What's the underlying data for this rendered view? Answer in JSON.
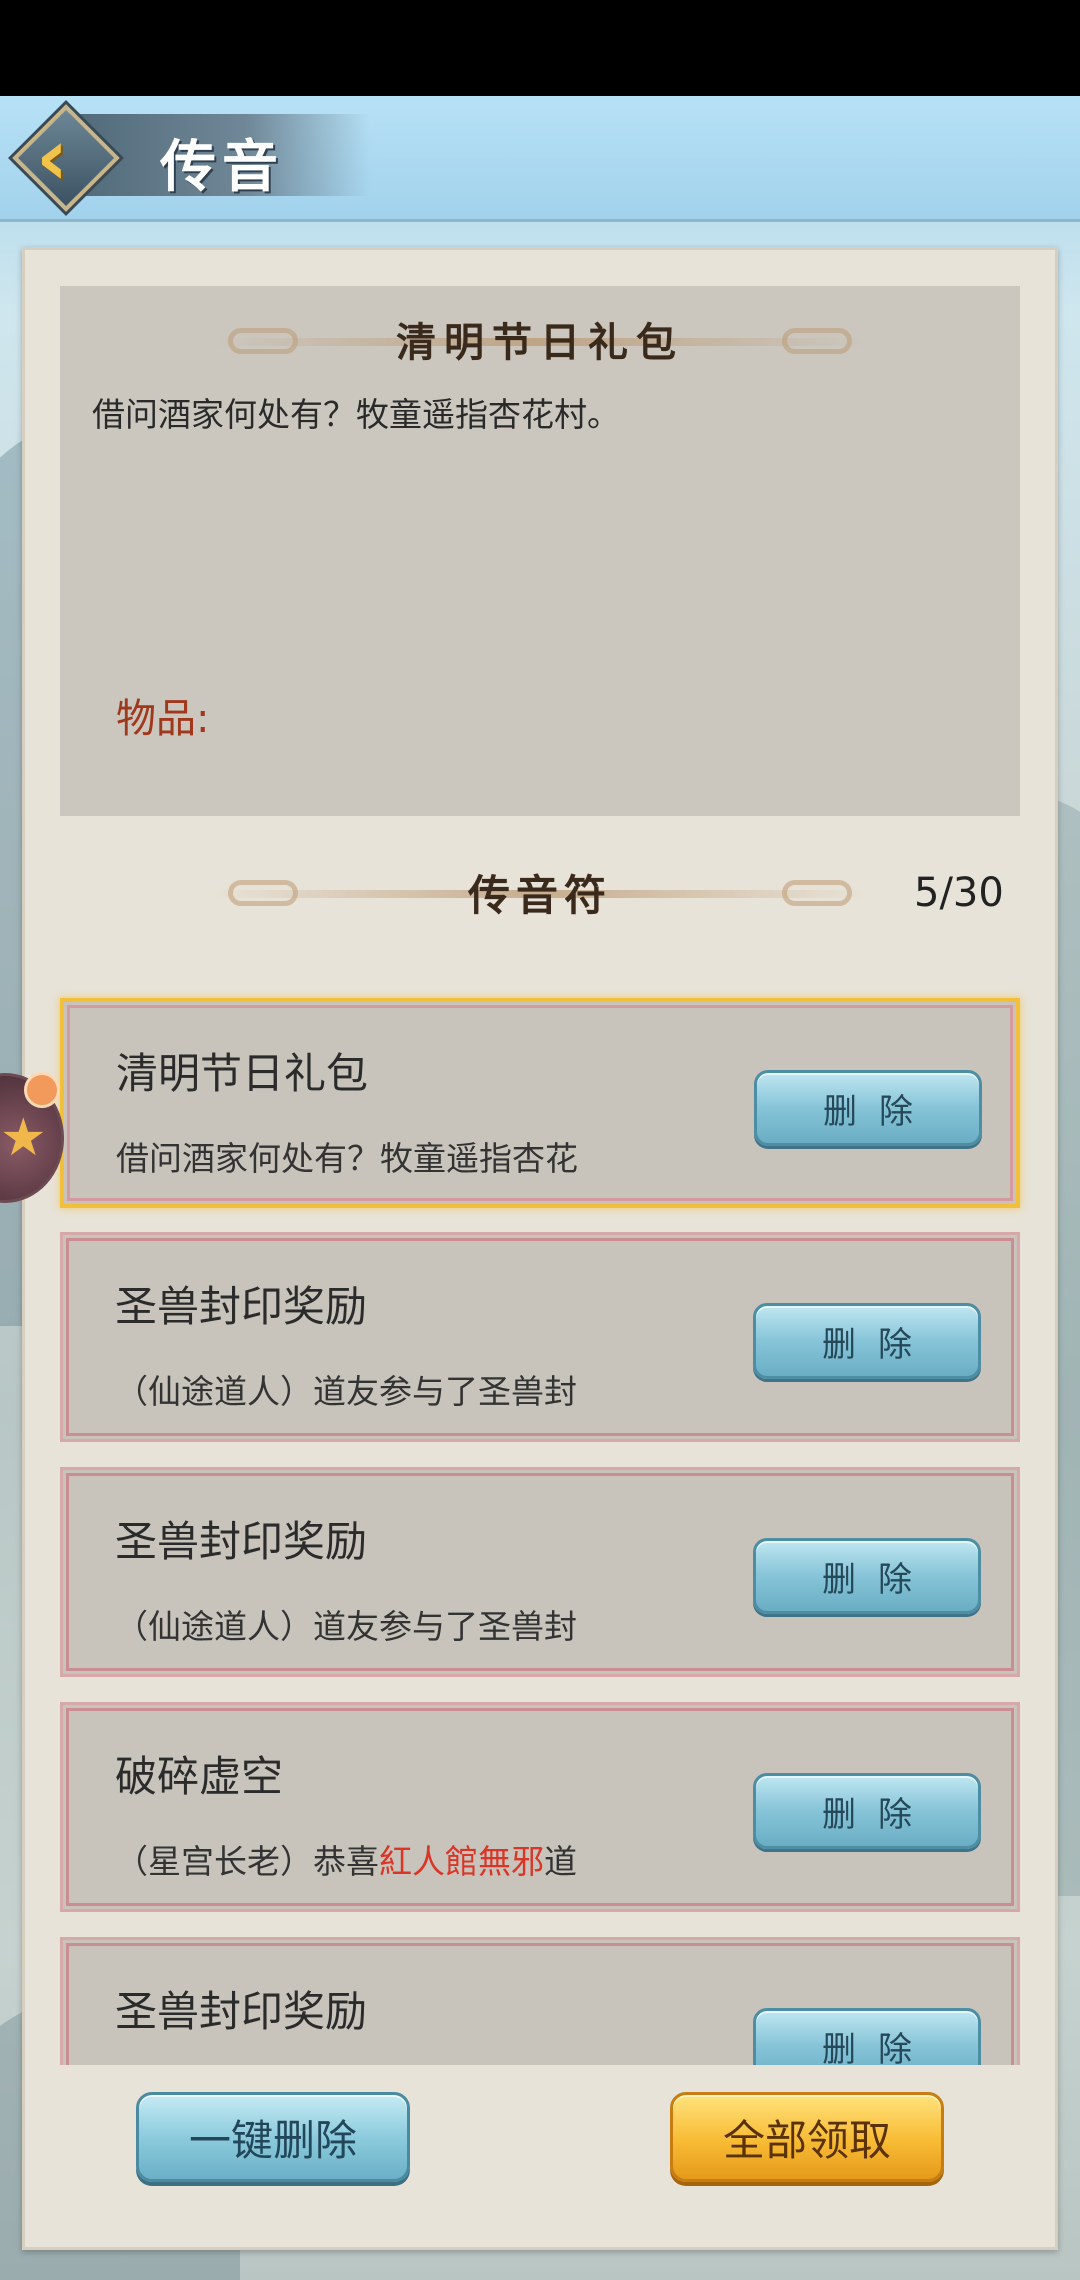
{
  "header": {
    "title": "传音"
  },
  "detail": {
    "title": "清明节日礼包",
    "body": "借问酒家何处有？牧童遥指杏花村。",
    "items_label": "物品:"
  },
  "section": {
    "title": "传音符",
    "count": "5/30"
  },
  "messages": [
    {
      "title": "清明节日礼包",
      "text": "借问酒家何处有？牧童遥指杏花",
      "delete_label": "删除",
      "selected": true
    },
    {
      "title": "圣兽封印奖励",
      "text": "（仙途道人）道友参与了圣兽封",
      "delete_label": "删除"
    },
    {
      "title": "圣兽封印奖励",
      "text": "（仙途道人）道友参与了圣兽封",
      "delete_label": "删除"
    },
    {
      "title": "破碎虚空",
      "text_before": "（星宫长老）恭喜",
      "text_highlight": "紅人館無邪",
      "text_after": "道",
      "delete_label": "删除"
    },
    {
      "title": "圣兽封印奖励",
      "delete_label": "删除"
    }
  ],
  "actions": {
    "delete_all": "一键删除",
    "claim_all": "全部领取"
  },
  "colors": {
    "highlight": "#d93628",
    "selected_border": "#f2bf3a",
    "items_label": "#a0381c"
  }
}
